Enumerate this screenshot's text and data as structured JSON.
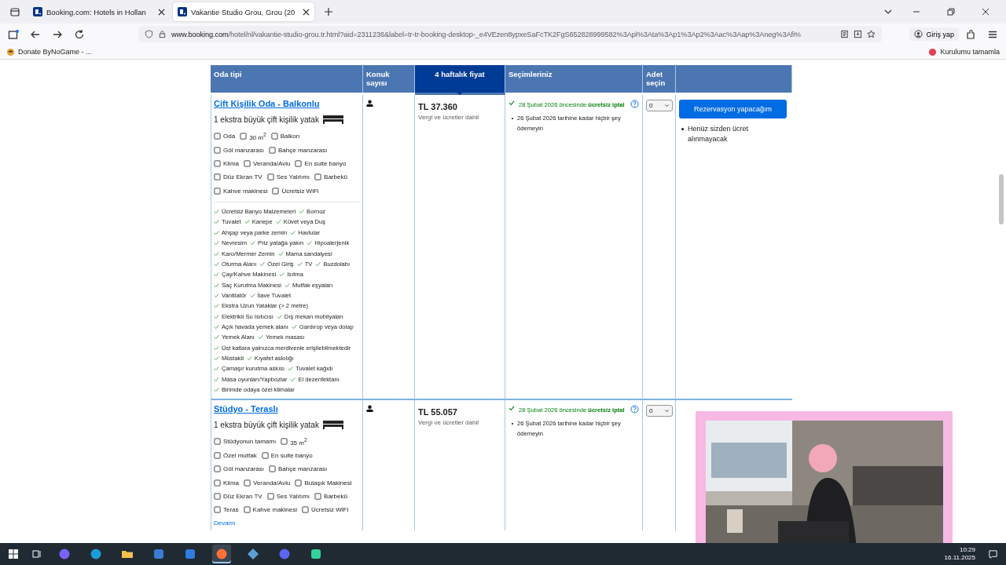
{
  "browser": {
    "tabs": [
      {
        "title": "Booking.com: Hotels in Hollan",
        "selected": false
      },
      {
        "title": "Vakantie Studio Grou, Grou (20",
        "selected": true
      }
    ],
    "url_host": "www.booking.com",
    "url_path": "/hotel/nl/vakantie-studio-grou.tr.html?aid=2311236&label=tr-tr-booking-desktop-_e4VEzen8ypxeSaFcTK2FgS652828999582%3Apl%3Ata%3Ap1%3Ap2%3Aac%3Aap%3Aneg%3Afi%",
    "sign_in": "Giriş yap",
    "bookmark": "Donate ByNoGame - ...",
    "setup": "Kurulumu tamamla"
  },
  "table": {
    "columns": [
      {
        "label": "Oda tipi",
        "highlighted": false
      },
      {
        "label": "Konuk sayısı",
        "highlighted": false
      },
      {
        "label": "4 haftalık fiyat",
        "highlighted": true
      },
      {
        "label": "Seçimleriniz",
        "highlighted": false
      },
      {
        "label": "Adet seçin",
        "highlighted": false
      }
    ],
    "rows": [
      {
        "name": "Çift Kişilik Oda - Balkonlu",
        "bed": "1 ekstra büyük çift kişilik yatak",
        "facilities": [
          [
            "Oda",
            "30 m$^{2}$",
            "Balkon"
          ],
          [
            "Göl manzarası",
            "Bahçe manzarası"
          ],
          [
            "Klima",
            "Veranda/Avlu",
            "En suite banyo"
          ],
          [
            "Düz Ekran TV",
            "Ses Yalıtımı",
            "Barbekü"
          ],
          [
            "Kahve makinesi",
            "Ücretsiz WiFi"
          ]
        ],
        "amenities": [
          [
            "Ücretsiz Banyo Malzemeleri",
            "Bornoz"
          ],
          [
            "Tuvalet",
            "Kanepe",
            "Küvet veya Duş"
          ],
          [
            "Ahşap veya parke zemin",
            "Havlular"
          ],
          [
            "Nevresim",
            "Priz yatağa yakın",
            "Hipoalerjenik"
          ],
          [
            "Karo/Mermer Zemin",
            "Mama sandalyesi"
          ],
          [
            "Oturma Alanı",
            "Özel Giriş",
            "TV",
            "Buzdolabı"
          ],
          [
            "Çay/Kahve Makinesi",
            "Isıtma"
          ],
          [
            "Saç Kurutma Makinesi",
            "Mutfak eşyaları"
          ],
          [
            "Vantilatör",
            "İlave Tuvalet"
          ],
          [
            "Ekstra Uzun Yataklar (> 2 metre)"
          ],
          [
            "Elektrikli Su Isıtıcısı",
            "Dış mekan mobilyaları"
          ],
          [
            "Açık havada yemek alanı",
            "Gardırop veya dolap"
          ],
          [
            "Yemek Alanı",
            "Yemek masası"
          ],
          [
            "Üst katlara yalnızca merdivenle erişilebilmektedir"
          ],
          [
            "Müstakil",
            "Kıyafet askılığı"
          ],
          [
            "Çamaşır kurutma askısı",
            "Tuvalet kağıdı"
          ],
          [
            "Masa oyunları/Yapbozlar",
            "El dezenfektanı"
          ],
          [
            "Birimde odaya özel klimalar"
          ]
        ],
        "price": "TL 37.360",
        "price_note": "Vergi ve ücretler dahil",
        "cancel": "28 Şubat 2026 öncesinde **ücretsiz iptal**",
        "pay": "26 Şubat 2026 tarihine kadar hiçbir şey ödemeyin",
        "quantity": "0"
      },
      {
        "name": "Stüdyo - Teraslı",
        "bed": "1 ekstra büyük çift kişilik yatak",
        "facilities": [
          [
            "Stüdyonun tamamı",
            "35 m$^{2}$"
          ],
          [
            "Özel mutfak",
            "En suite banyo"
          ],
          [
            "Göl manzarası",
            "Bahçe manzarası"
          ],
          [
            "Klima",
            "Veranda/Avlu",
            "Bulaşık Makinesi"
          ],
          [
            "Düz Ekran TV",
            "Ses Yalıtımı",
            "Barbekü"
          ],
          [
            "Teras",
            "Kahve makinesi",
            "Ücretsiz WiFi"
          ]
        ],
        "more": "Devamı",
        "price": "TL 55.057",
        "price_note": "Vergi ve ücretler dahil",
        "cancel": "28 Şubat 2026 öncesinde **ücretsiz iptal**",
        "pay": "26 Şubat 2026 tarihine kadar hiçbir şey ödemeyin",
        "quantity": "0"
      }
    ],
    "reserve_button": "Rezervasyon yapacağım",
    "reserve_note": "Henüz sizden ücret alınmayacak"
  },
  "taskbar": {
    "apps": [
      {
        "kind": "copilot",
        "selected": false
      },
      {
        "kind": "edge",
        "selected": false
      },
      {
        "kind": "folder",
        "selected": false
      },
      {
        "kind": "store",
        "selected": false
      },
      {
        "kind": "mail",
        "selected": false
      },
      {
        "kind": "firefox",
        "selected": true
      },
      {
        "kind": "diamond",
        "selected": false
      },
      {
        "kind": "chat",
        "selected": false
      },
      {
        "kind": "game",
        "selected": false
      }
    ],
    "time": "10:29",
    "date": "16.11.2025"
  }
}
